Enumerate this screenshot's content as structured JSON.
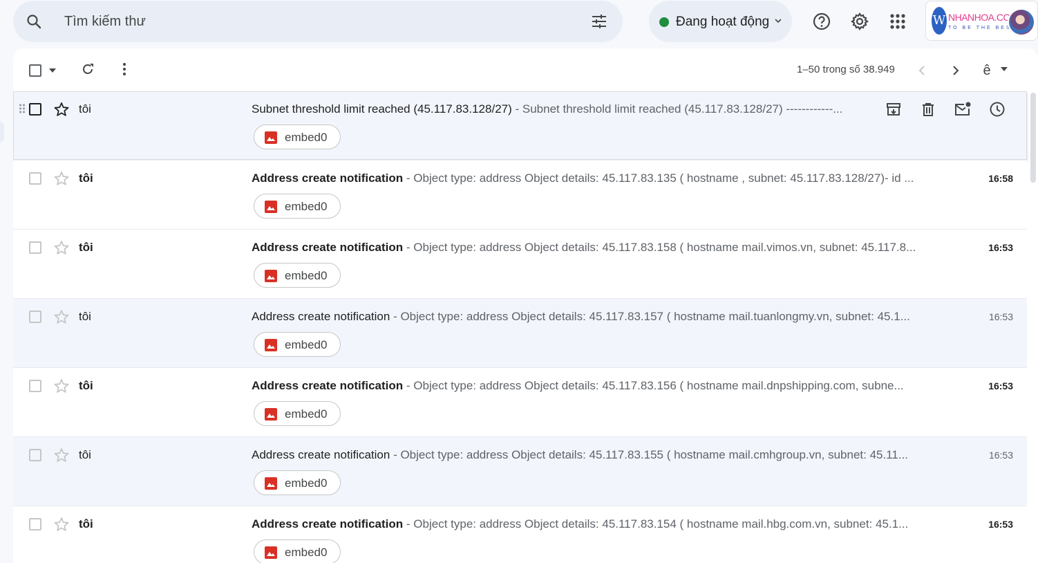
{
  "search": {
    "placeholder": "Tìm kiếm thư"
  },
  "status": {
    "label": "Đang hoạt động"
  },
  "brand": {
    "name": "NHANHOA.COM",
    "tagline": "TO BE THE BEST",
    "logo_letter": "W"
  },
  "icons": {
    "search": "search-icon",
    "filter": "tune-icon",
    "help": "help-icon",
    "settings": "gear-icon",
    "apps": "apps-grid-icon",
    "refresh": "refresh-icon",
    "more": "more-vert-icon",
    "archive": "archive-icon",
    "delete": "trash-icon",
    "mark_unread": "mark-unread-icon",
    "snooze": "snooze-clock-icon",
    "attachment": "image-icon",
    "star": "star-icon"
  },
  "colors": {
    "status_dot": "#1e8e3e",
    "attachment_icon": "#d93025",
    "row_read_bg": "#f2f6fc"
  },
  "toolbar": {
    "range": "1–50 trong số 38.949",
    "input_tool": "ê"
  },
  "emails": [
    {
      "sender": "tôi",
      "subject": "Subnet threshold limit reached (45.117.83.128/27)",
      "snippet": " - Subnet threshold limit reached (45.117.83.128/27) ------------...",
      "time": "",
      "attachment": "embed0"
    },
    {
      "sender": "tôi",
      "subject": "Address create notification",
      "snippet": " - Object type: address Object details: 45.117.83.135 ( hostname , subnet: 45.117.83.128/27)- id ...",
      "time": "16:58",
      "attachment": "embed0"
    },
    {
      "sender": "tôi",
      "subject": "Address create notification",
      "snippet": " - Object type: address Object details: 45.117.83.158 ( hostname mail.vimos.vn, subnet: 45.117.8...",
      "time": "16:53",
      "attachment": "embed0"
    },
    {
      "sender": "tôi",
      "subject": "Address create notification",
      "snippet": " - Object type: address Object details: 45.117.83.157 ( hostname mail.tuanlongmy.vn, subnet: 45.1...",
      "time": "16:53",
      "attachment": "embed0"
    },
    {
      "sender": "tôi",
      "subject": "Address create notification",
      "snippet": " - Object type: address Object details: 45.117.83.156 ( hostname mail.dnpshipping.com, subne...",
      "time": "16:53",
      "attachment": "embed0"
    },
    {
      "sender": "tôi",
      "subject": "Address create notification",
      "snippet": " - Object type: address Object details: 45.117.83.155 ( hostname mail.cmhgroup.vn, subnet: 45.11...",
      "time": "16:53",
      "attachment": "embed0"
    },
    {
      "sender": "tôi",
      "subject": "Address create notification",
      "snippet": " - Object type: address Object details: 45.117.83.154 ( hostname mail.hbg.com.vn, subnet: 45.1...",
      "time": "16:53",
      "attachment": "embed0"
    }
  ]
}
